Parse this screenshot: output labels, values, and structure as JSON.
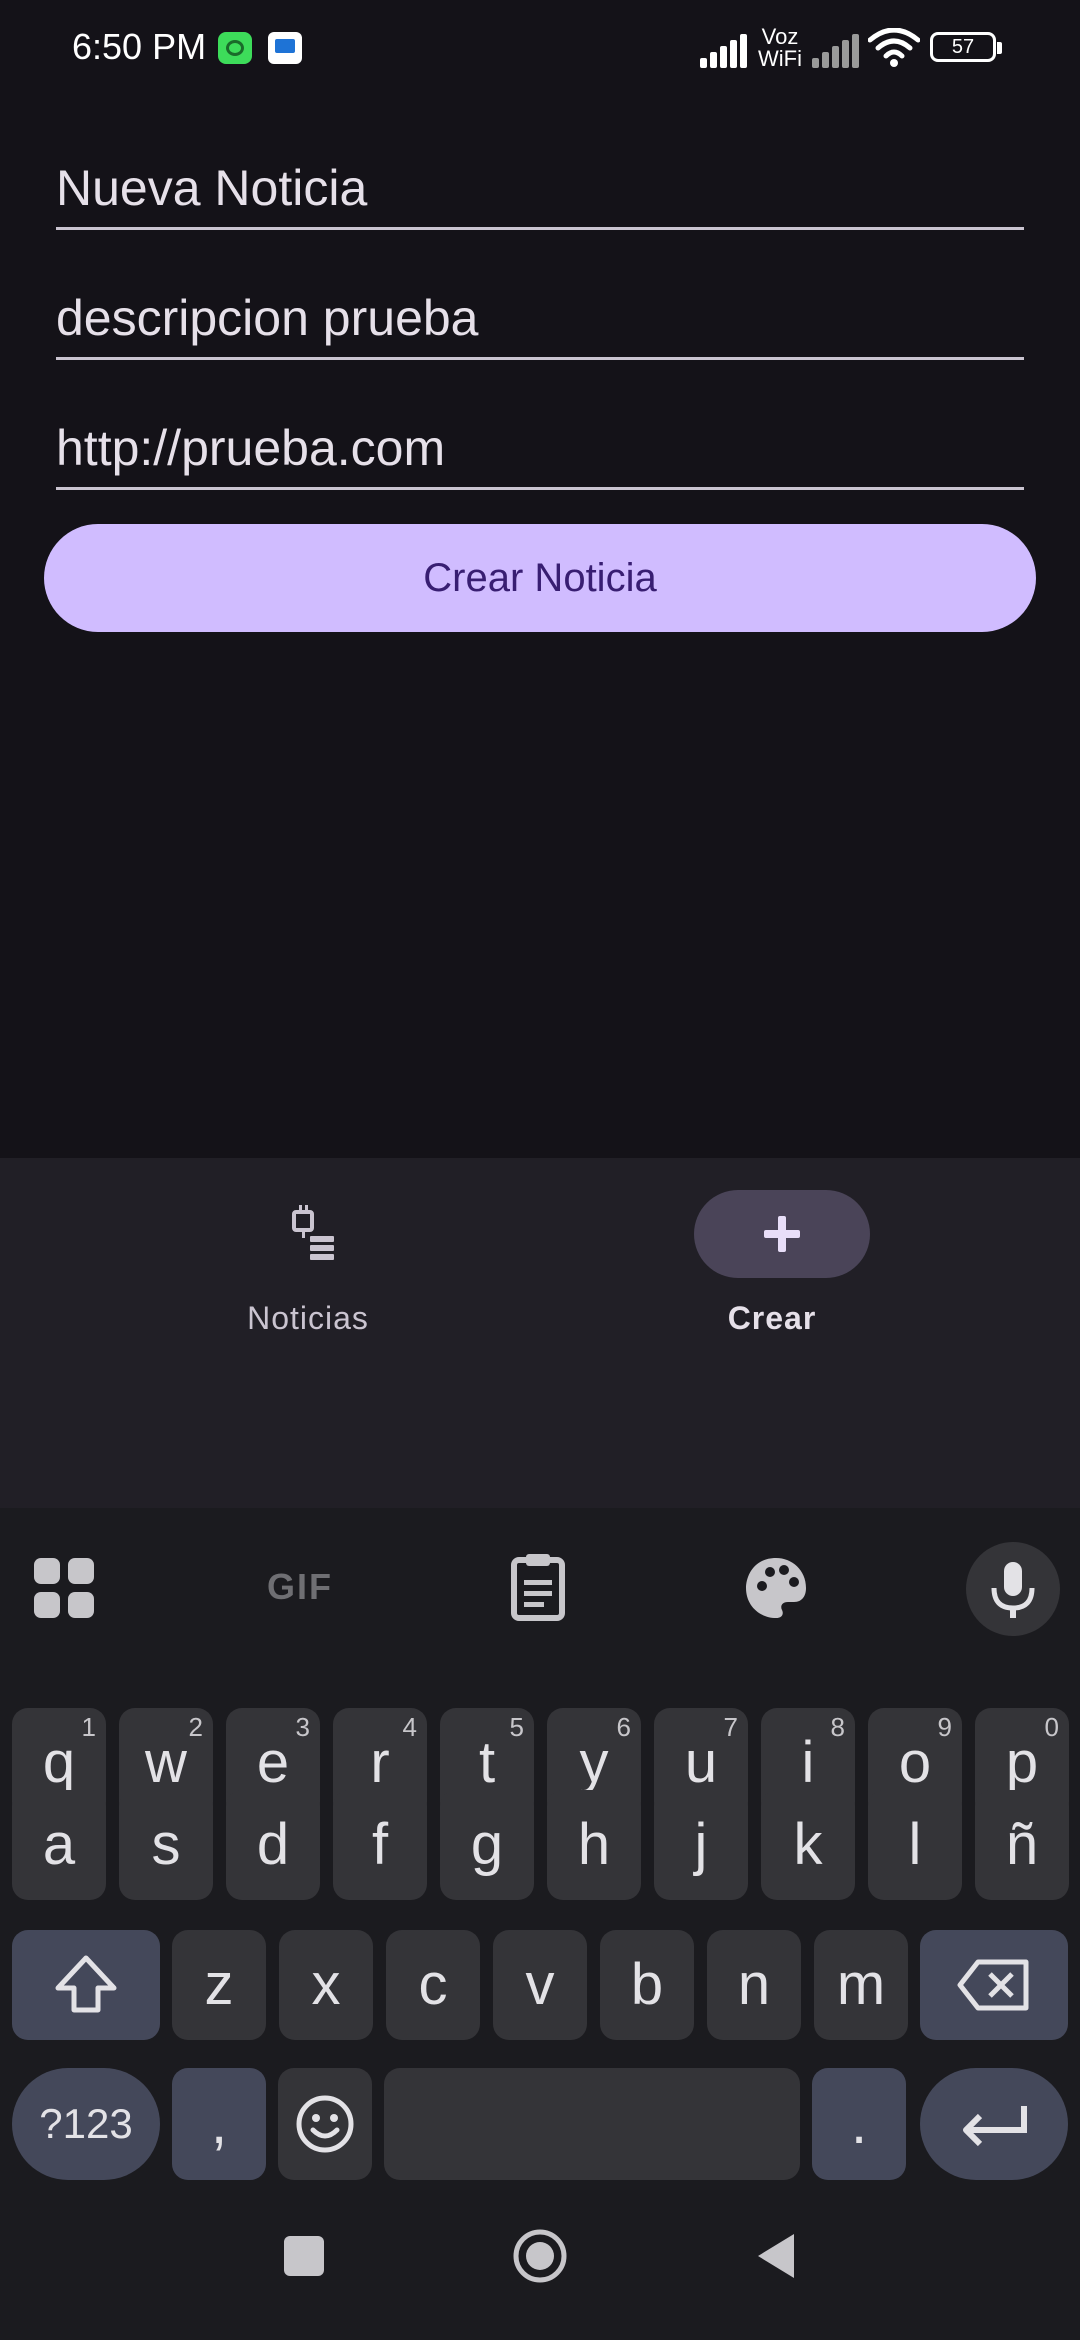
{
  "status_bar": {
    "time": "6:50 PM",
    "wifi_label_line1": "Voz",
    "wifi_label_line2": "WiFi",
    "battery": "57"
  },
  "form": {
    "title_value": "Nueva Noticia",
    "description_value": "descripcion prueba",
    "url_value": "http://prueba.com",
    "submit_label": "Crear Noticia"
  },
  "bottom_nav": {
    "items": [
      {
        "label": "Noticias",
        "icon": "news-list-icon",
        "selected": false
      },
      {
        "label": "Crear",
        "icon": "plus-icon",
        "selected": true
      }
    ]
  },
  "keyboard": {
    "toolbar": {
      "gif_label": "GIF"
    },
    "row1": [
      {
        "k": "q",
        "h": "1"
      },
      {
        "k": "w",
        "h": "2"
      },
      {
        "k": "e",
        "h": "3"
      },
      {
        "k": "r",
        "h": "4"
      },
      {
        "k": "t",
        "h": "5"
      },
      {
        "k": "y",
        "h": "6"
      },
      {
        "k": "u",
        "h": "7"
      },
      {
        "k": "i",
        "h": "8"
      },
      {
        "k": "o",
        "h": "9"
      },
      {
        "k": "p",
        "h": "0"
      }
    ],
    "row2": [
      "a",
      "s",
      "d",
      "f",
      "g",
      "h",
      "j",
      "k",
      "l",
      "ñ"
    ],
    "row3": [
      "z",
      "x",
      "c",
      "v",
      "b",
      "n",
      "m"
    ],
    "symbols_label": "?123",
    "comma_label": ",",
    "period_label": "."
  },
  "colors": {
    "background": "#141218",
    "primary_container": "#d0bcff",
    "on_primary": "#381e72",
    "nav_background": "#211f26",
    "selected_pill": "#4a4458",
    "keyboard_background": "#1b1b1f"
  }
}
